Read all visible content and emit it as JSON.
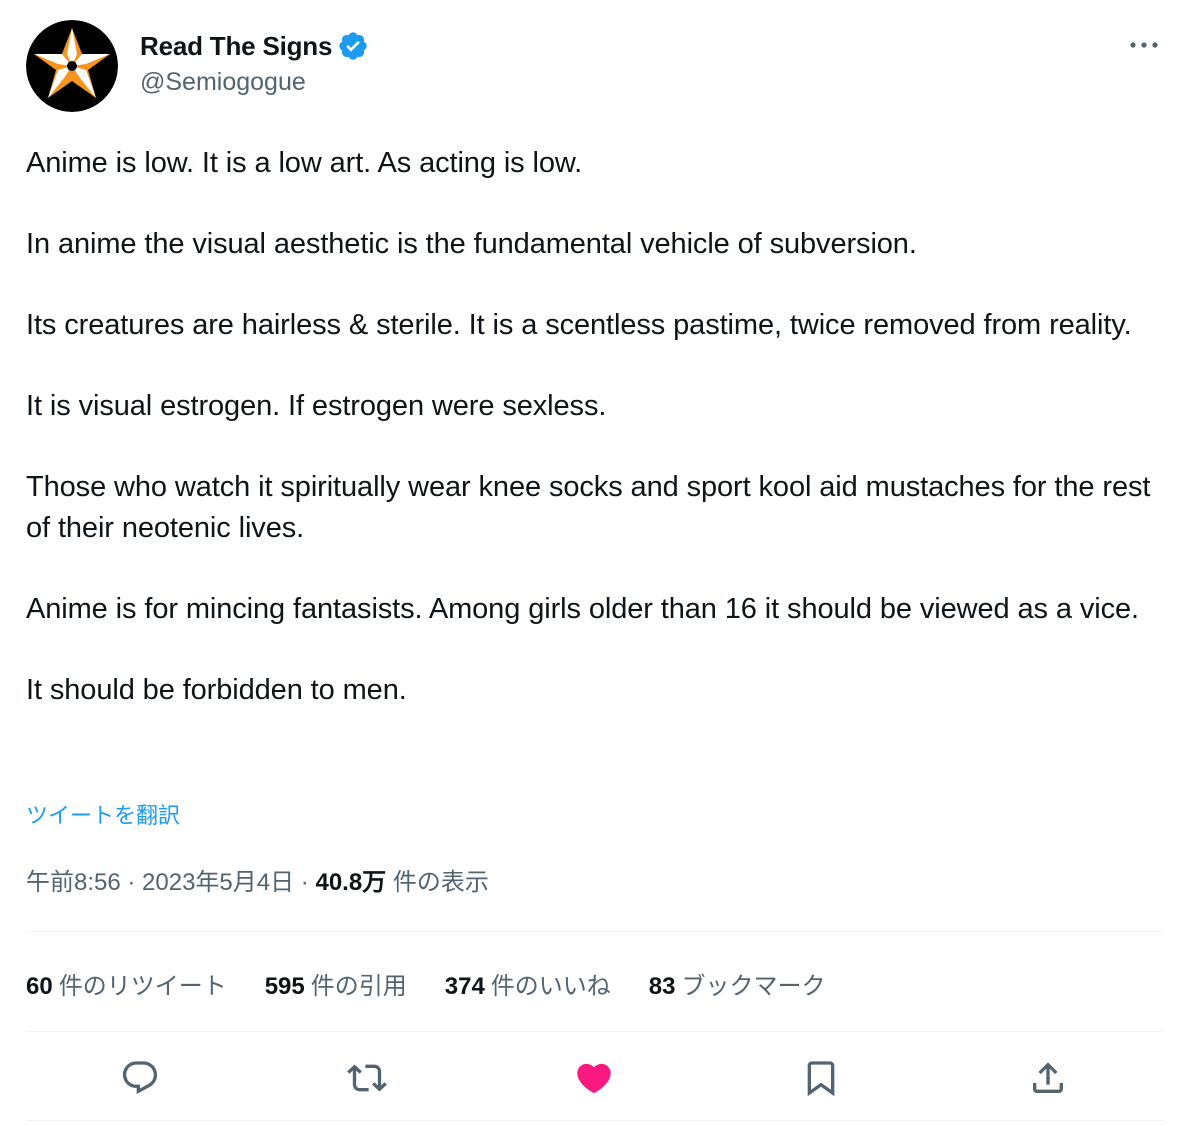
{
  "author": {
    "display_name": "Read The Signs",
    "handle": "@Semiogogue",
    "verified": true,
    "avatar_icon": "star-emblem-avatar"
  },
  "tweet": {
    "paragraphs": [
      "Anime is low. It is a low art. As acting is low.",
      "In anime the visual aesthetic is the fundamental vehicle of subversion.",
      "Its creatures are hairless & sterile. It is a scentless pastime, twice removed from reality.",
      "It is visual estrogen. If estrogen were sexless.",
      "Those who watch it spiritually wear knee socks and sport kool aid mustaches for the rest of their neotenic lives.",
      "Anime is for mincing fantasists. Among girls older than 16 it should be viewed as a vice.",
      "It should be forbidden to men."
    ],
    "translate_label": "ツイートを翻訳"
  },
  "meta": {
    "time": "午前8:56",
    "separator": " · ",
    "date": "2023年5月4日",
    "views_count": "40.8万",
    "views_label": " 件の表示"
  },
  "stats": {
    "retweets": {
      "count": "60",
      "label": "件のリツイート"
    },
    "quotes": {
      "count": "595",
      "label": "件の引用"
    },
    "likes": {
      "count": "374",
      "label": "件のいいね"
    },
    "bookmarks": {
      "count": "83",
      "label": "ブックマーク"
    }
  },
  "actions": {
    "reply_icon": "reply-icon",
    "retweet_icon": "retweet-icon",
    "like_icon": "heart-icon",
    "bookmark_icon": "bookmark-icon",
    "share_icon": "share-icon",
    "liked": true
  },
  "colors": {
    "text": "#0f1419",
    "secondary": "#536471",
    "link": "#1d9bf0",
    "verified": "#1d9bf0",
    "like": "#f91880",
    "divider": "#eff3f4",
    "avatar_orange": "#f7941d"
  }
}
